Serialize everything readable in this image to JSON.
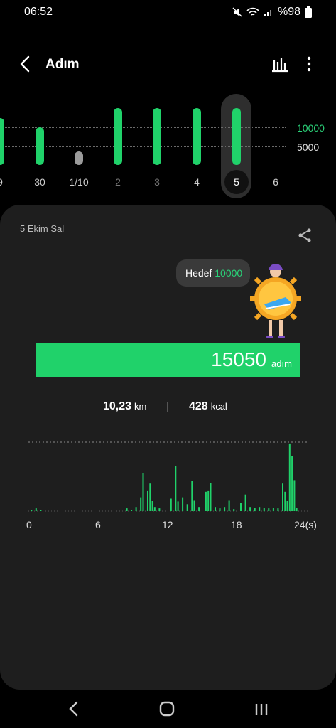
{
  "status_bar": {
    "time": "06:52",
    "battery": "%98"
  },
  "header": {
    "title": "Adım"
  },
  "weekly": {
    "goal_label": "10000",
    "mid_label": "5000",
    "colors": {
      "accent": "#20d26a",
      "grid": "#6b6b6b"
    },
    "days": [
      {
        "label": "9",
        "goal_met": true
      },
      {
        "label": "30",
        "goal_met": true
      },
      {
        "label": "1/10",
        "goal_met": false
      },
      {
        "label": "2",
        "goal_met": true
      },
      {
        "label": "3",
        "goal_met": true
      },
      {
        "label": "4",
        "goal_met": true
      },
      {
        "label": "5",
        "goal_met": true,
        "selected": true
      },
      {
        "label": "6"
      }
    ]
  },
  "detail": {
    "date": "5 Ekim Sal",
    "goal_prefix": "Hedef",
    "goal_value": "10000",
    "steps": "15050",
    "steps_unit": "adım",
    "distance": "10,23",
    "distance_unit": "km",
    "calories": "428",
    "calories_unit": "kcal"
  },
  "chart_data": {
    "type": "bar",
    "xlabel": "",
    "ylabel": "",
    "x_tick_labels": [
      "0",
      "6",
      "12",
      "18",
      "24(s)"
    ],
    "xlim": [
      0,
      24
    ],
    "ylim": [
      0,
      1
    ],
    "hour_positions": [
      0.2,
      0.6,
      1.0,
      8.4,
      8.8,
      9.2,
      9.6,
      9.8,
      10.2,
      10.4,
      10.6,
      10.8,
      11.2,
      12.2,
      12.6,
      12.8,
      13.2,
      13.6,
      14.0,
      14.2,
      14.6,
      15.2,
      15.4,
      15.6,
      16.0,
      16.4,
      16.8,
      17.2,
      17.6,
      18.2,
      18.6,
      19.0,
      19.4,
      19.8,
      20.2,
      20.6,
      21.0,
      21.4,
      21.8,
      22.0,
      22.2,
      22.4,
      22.6,
      22.8,
      23.0
    ],
    "values": [
      0.02,
      0.04,
      0.02,
      0.04,
      0.02,
      0.06,
      0.2,
      0.55,
      0.3,
      0.4,
      0.15,
      0.06,
      0.04,
      0.18,
      0.66,
      0.14,
      0.2,
      0.1,
      0.44,
      0.16,
      0.06,
      0.28,
      0.3,
      0.41,
      0.06,
      0.04,
      0.06,
      0.16,
      0.03,
      0.12,
      0.24,
      0.06,
      0.05,
      0.06,
      0.05,
      0.04,
      0.05,
      0.04,
      0.4,
      0.28,
      0.15,
      0.98,
      0.8,
      0.45,
      0.05
    ]
  }
}
